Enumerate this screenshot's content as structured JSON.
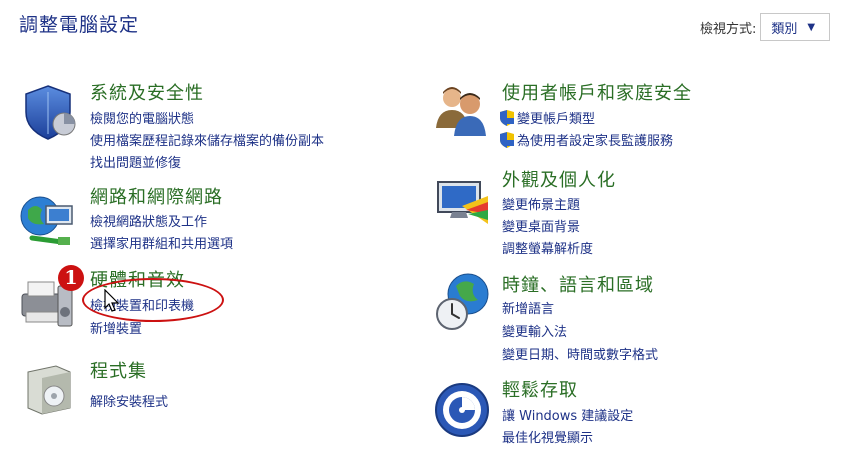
{
  "header": {
    "title": "調整電腦設定",
    "view_by_label": "檢視方式:",
    "view_by_value": "類別"
  },
  "categories": [
    {
      "icon": "shield-icon",
      "title": "系統及安全性",
      "links": [
        "檢閱您的電腦狀態",
        "使用檔案歷程記錄來儲存檔案的備份副本",
        "找出問題並修復"
      ]
    },
    {
      "icon": "network-globe-icon",
      "title": "網路和網際網路",
      "links": [
        "檢視網路狀態及工作",
        "選擇家用群組和共用選項"
      ]
    },
    {
      "icon": "printer-icon",
      "title": "硬體和音效",
      "links": [
        "檢視裝置和印表機",
        "新增裝置"
      ]
    },
    {
      "icon": "programs-box-icon",
      "title": "程式集",
      "links": [
        "解除安裝程式"
      ]
    },
    {
      "icon": "users-icon",
      "title": "使用者帳戶和家庭安全",
      "links": [
        "變更帳戶類型",
        "為使用者設定家長監護服務"
      ]
    },
    {
      "icon": "monitor-palette-icon",
      "title": "外觀及個人化",
      "links": [
        "變更佈景主題",
        "變更桌面背景",
        "調整螢幕解析度"
      ]
    },
    {
      "icon": "clock-globe-icon",
      "title": "時鐘、語言和區域",
      "links": [
        "新增語言",
        "變更輸入法",
        "變更日期、時間或數字格式"
      ]
    },
    {
      "icon": "ease-of-access-icon",
      "title": "輕鬆存取",
      "links": [
        "讓 Windows 建議設定",
        "最佳化視覺顯示"
      ]
    }
  ],
  "annotation": {
    "marker_number": "1"
  },
  "colors": {
    "title": "#1e3287",
    "category": "#2a6e25",
    "link": "#1e3287",
    "annotation": "#cc1111"
  }
}
